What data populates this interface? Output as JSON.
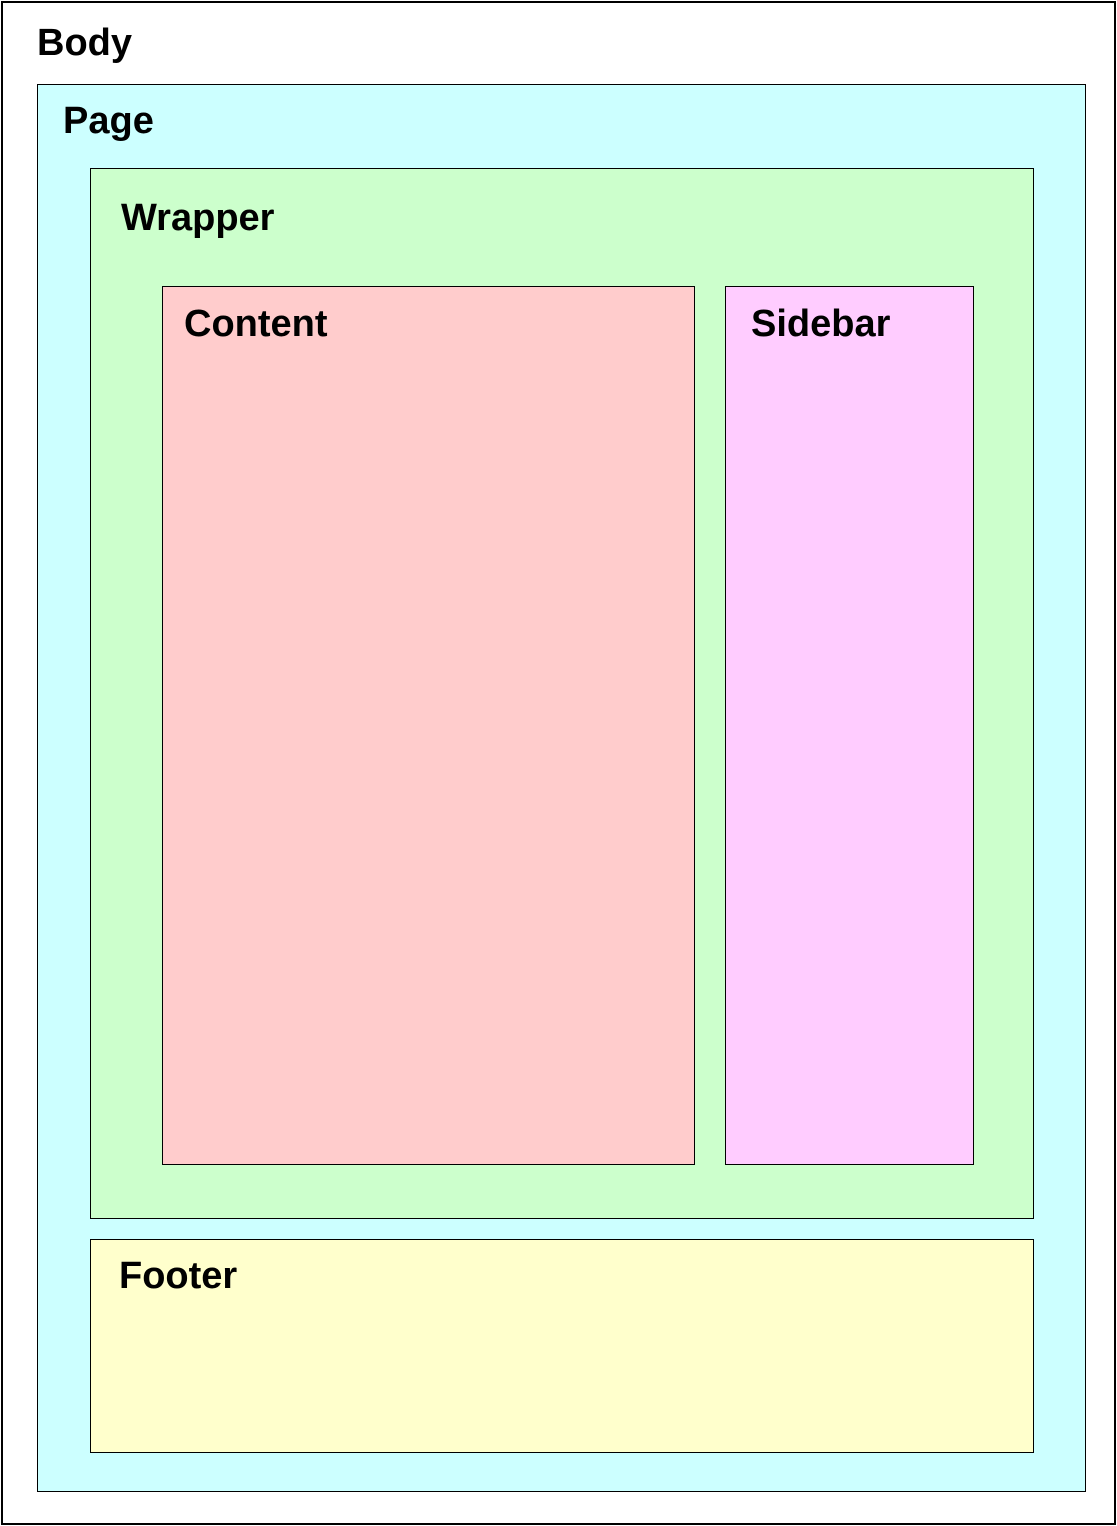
{
  "diagram": {
    "body": {
      "label": "Body",
      "color": "#ffffff"
    },
    "page": {
      "label": "Page",
      "color": "#ccffff"
    },
    "wrapper": {
      "label": "Wrapper",
      "color": "#ccffcc"
    },
    "content": {
      "label": "Content",
      "color": "#ffcccc"
    },
    "sidebar": {
      "label": "Sidebar",
      "color": "#ffccff"
    },
    "footer": {
      "label": "Footer",
      "color": "#ffffcc"
    }
  }
}
